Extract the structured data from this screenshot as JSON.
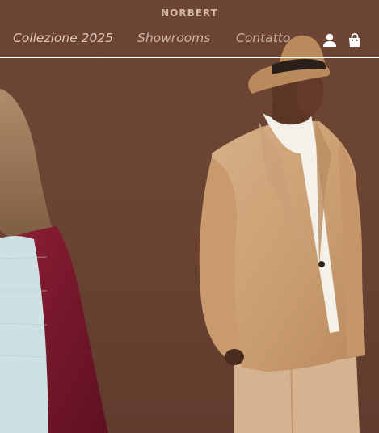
{
  "brand": {
    "logo_text": "NORBERT"
  },
  "nav": {
    "items": [
      {
        "label": "Collezione 2025"
      },
      {
        "label": "Showrooms"
      },
      {
        "label": "Contatto"
      }
    ]
  },
  "header_actions": {
    "user_icon": "user-icon",
    "bag_icon": "shopping-bag-icon"
  },
  "colors": {
    "background": "#6b4432",
    "nav_text": "#cbb3a6",
    "divider": "#ffffff",
    "icons": "#ffffff"
  },
  "hero": {
    "image": "fashion-models-photo"
  }
}
